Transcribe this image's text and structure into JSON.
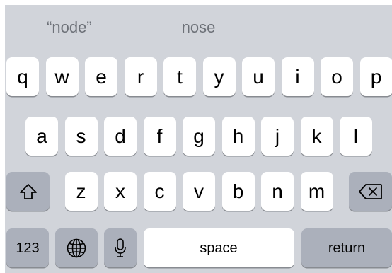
{
  "suggestions": [
    "“node”",
    "nose",
    ""
  ],
  "rows": {
    "top": [
      "q",
      "w",
      "e",
      "r",
      "t",
      "y",
      "u",
      "i",
      "o",
      "p"
    ],
    "middle": [
      "a",
      "s",
      "d",
      "f",
      "g",
      "h",
      "j",
      "k",
      "l"
    ],
    "bottom": [
      "z",
      "x",
      "c",
      "v",
      "b",
      "n",
      "m"
    ]
  },
  "keys": {
    "numbers_label": "123",
    "space_label": "space",
    "return_label": "return"
  },
  "icons": {
    "shift": "shift-arrow-icon",
    "delete": "delete-backspace-icon",
    "globe": "globe-icon",
    "mic": "microphone-icon"
  },
  "colors": {
    "keyboard_bg": "#d1d4da",
    "letter_key": "#ffffff",
    "function_key": "#abb0bb",
    "suggestion_text": "#6d7178"
  }
}
